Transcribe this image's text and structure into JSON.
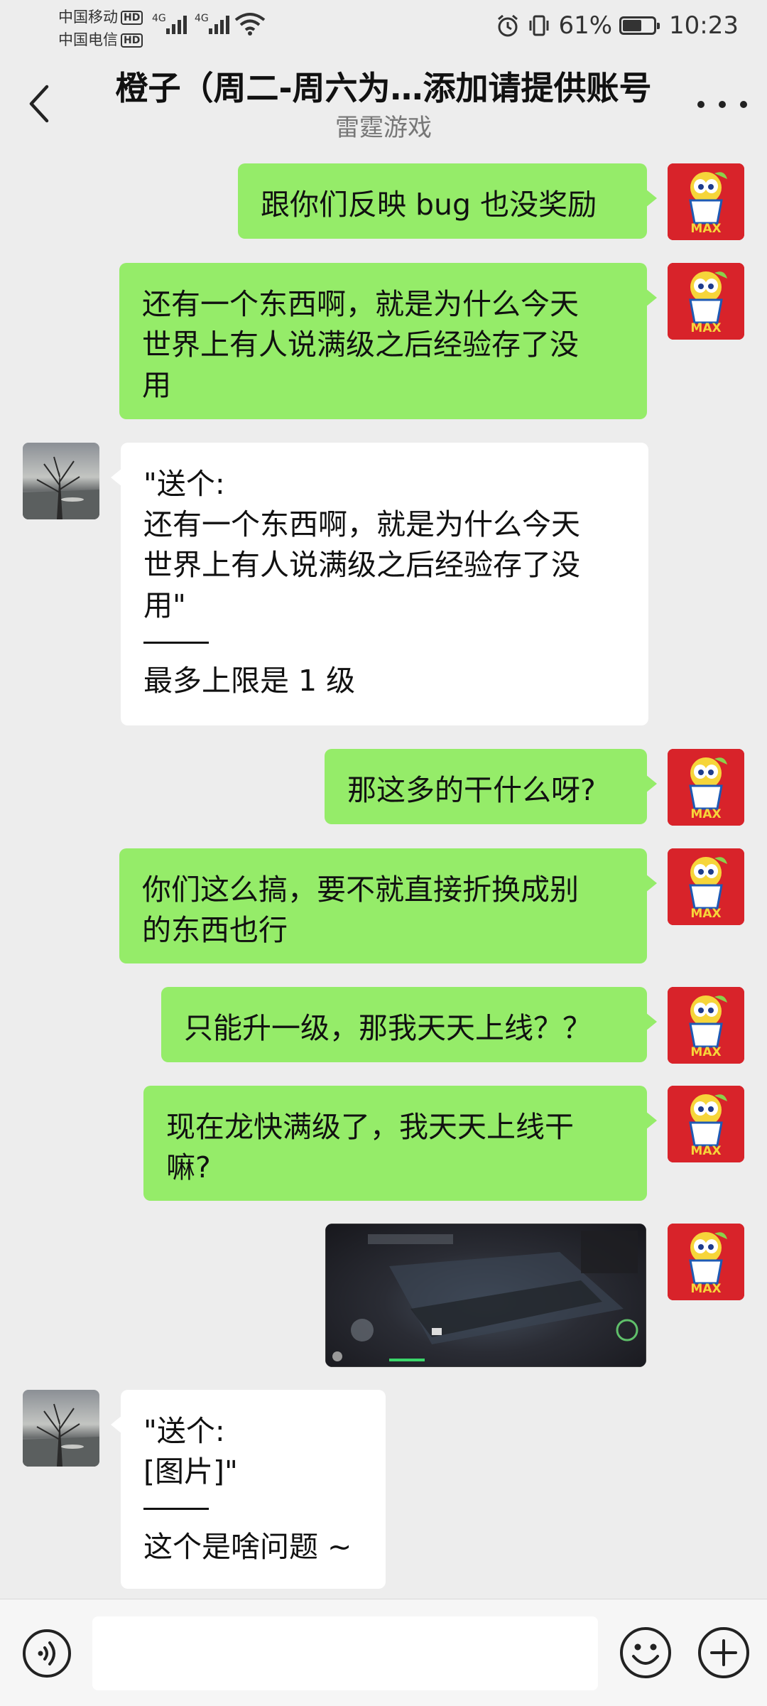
{
  "status_bar": {
    "carrier1": "中国移动",
    "carrier2": "中国电信",
    "hd": "HD",
    "network": "4G",
    "battery_percent": "61%",
    "battery_level": 0.61,
    "time": "10:23"
  },
  "header": {
    "title": "橙子（周二-周六为…添加请提供账号",
    "subtitle": "雷霆游戏"
  },
  "messages": [
    {
      "from": "me",
      "text": "跟你们反映 bug 也没奖励"
    },
    {
      "from": "me",
      "text": "还有一个东西啊，就是为什么今天\n世界上有人说满级之后经验存了没\n用"
    },
    {
      "from": "them",
      "quote": "\"送个:\n还有一个东西啊，就是为什么今天\n世界上有人说满级之后经验存了没\n用\"",
      "text": "最多上限是 1 级"
    },
    {
      "from": "me",
      "text": "那这多的干什么呀?"
    },
    {
      "from": "me",
      "text": "你们这么搞，要不就直接折换成别\n的东西也行"
    },
    {
      "from": "me",
      "text": "只能升一级，那我天天上线？？"
    },
    {
      "from": "me",
      "text": "现在龙快满级了，我天天上线干\n嘛?"
    },
    {
      "from": "me",
      "type": "image"
    },
    {
      "from": "them",
      "quote": "\"送个:\n[图片]\"",
      "text": "这个是啥问题 ~"
    }
  ],
  "avatar_me": {
    "badge": "MAX"
  },
  "colors": {
    "background": "#ededed",
    "bubble_out": "#95ec69",
    "bubble_in": "#ffffff",
    "avatar_me_bg": "#d8232a"
  },
  "icons": {
    "back": "chevron-left-icon",
    "more": "more-dots-icon",
    "voice": "voice-icon",
    "emoji": "emoji-icon",
    "plus": "plus-icon"
  }
}
